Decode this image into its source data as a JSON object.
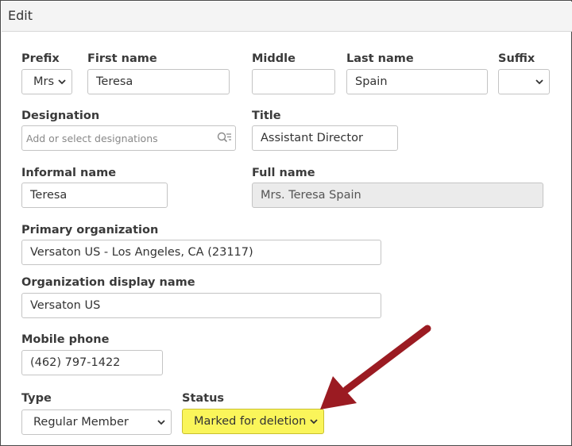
{
  "window": {
    "title": "Edit"
  },
  "form": {
    "prefix": {
      "label": "Prefix",
      "value": "Mrs"
    },
    "first_name": {
      "label": "First name",
      "value": "Teresa"
    },
    "middle": {
      "label": "Middle",
      "value": ""
    },
    "last_name": {
      "label": "Last name",
      "value": "Spain"
    },
    "suffix": {
      "label": "Suffix",
      "value": ""
    },
    "designation": {
      "label": "Designation",
      "placeholder": "Add or select designations"
    },
    "title": {
      "label": "Title",
      "value": "Assistant Director"
    },
    "informal_name": {
      "label": "Informal name",
      "value": "Teresa"
    },
    "full_name": {
      "label": "Full name",
      "value": "Mrs. Teresa Spain"
    },
    "primary_organization": {
      "label": "Primary organization",
      "value": "Versaton US - Los Angeles, CA (23117)"
    },
    "organization_display_name": {
      "label": "Organization display name",
      "value": "Versaton US"
    },
    "mobile_phone": {
      "label": "Mobile phone",
      "value": "(462) 797-1422"
    },
    "type": {
      "label": "Type",
      "value": "Regular Member"
    },
    "status": {
      "label": "Status",
      "value": "Marked for deletion"
    }
  },
  "colors": {
    "highlight": "#faf55a",
    "arrow": "#9b1b22",
    "readonly_bg": "#ebebeb"
  },
  "icons": {
    "select_chevron": "chevron-down-icon",
    "designation_picker": "search-list-icon",
    "annotation": "arrow-icon"
  }
}
